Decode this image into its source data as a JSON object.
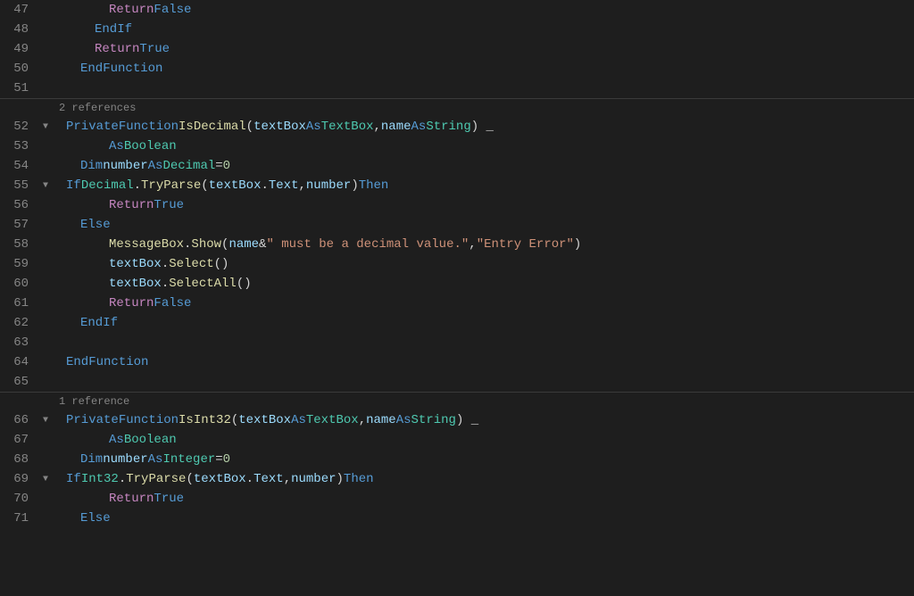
{
  "colors": {
    "bg": "#1e1e1e",
    "linenum": "#858585",
    "separator": "#3a3a3a",
    "keyword": "#569cd6",
    "keyword2": "#c586c0",
    "type": "#4ec9b0",
    "param": "#9cdcfe",
    "fn": "#dcdcaa",
    "string": "#ce9178",
    "number": "#b5cea8",
    "plain": "#d4d4d4",
    "comment": "#6a9955"
  },
  "lines": [
    {
      "num": 47,
      "type": "code"
    },
    {
      "num": 48,
      "type": "code"
    },
    {
      "num": 49,
      "type": "code"
    },
    {
      "num": 50,
      "type": "code"
    },
    {
      "num": 51,
      "type": "empty"
    },
    {
      "num": null,
      "type": "separator"
    },
    {
      "num": null,
      "type": "ref",
      "text": "2 references"
    },
    {
      "num": 52,
      "type": "code"
    },
    {
      "num": 53,
      "type": "code"
    },
    {
      "num": 54,
      "type": "code"
    },
    {
      "num": 55,
      "type": "code"
    },
    {
      "num": 56,
      "type": "code"
    },
    {
      "num": 57,
      "type": "code"
    },
    {
      "num": 58,
      "type": "code"
    },
    {
      "num": 59,
      "type": "code"
    },
    {
      "num": 60,
      "type": "code"
    },
    {
      "num": 61,
      "type": "code"
    },
    {
      "num": 62,
      "type": "code"
    },
    {
      "num": 63,
      "type": "empty"
    },
    {
      "num": 64,
      "type": "code"
    },
    {
      "num": 65,
      "type": "empty"
    },
    {
      "num": null,
      "type": "separator"
    },
    {
      "num": null,
      "type": "ref",
      "text": "1 reference"
    },
    {
      "num": 66,
      "type": "code"
    },
    {
      "num": 67,
      "type": "code"
    },
    {
      "num": 68,
      "type": "code"
    },
    {
      "num": 69,
      "type": "code"
    },
    {
      "num": 70,
      "type": "code"
    },
    {
      "num": 71,
      "type": "code"
    }
  ]
}
